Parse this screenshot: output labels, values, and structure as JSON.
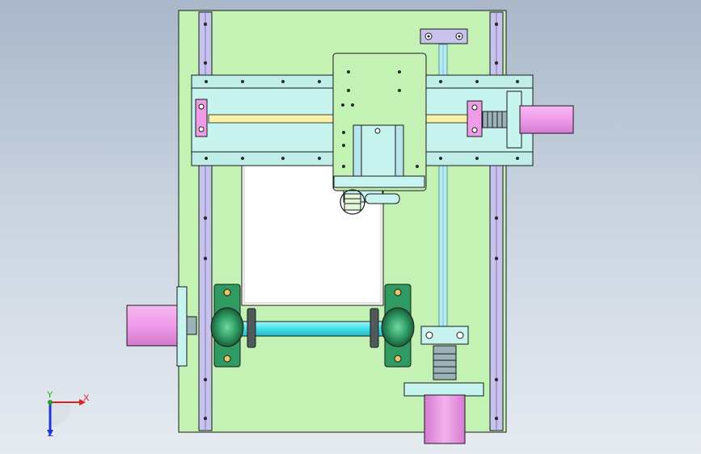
{
  "viewport": {
    "background_top": "#a9b7c9",
    "background_bottom": "#e6ebf1"
  },
  "colors": {
    "plate_green": "#c3f2b4",
    "rail_purple": "#c7c3ec",
    "rail_cyan": "#c8f4f0",
    "motor_pink": "#ee9be8",
    "shaft_cyan": "#56e8f0",
    "bearing_green": "#2f9a62",
    "rod_yellow": "#f6f3a8",
    "outline": "#1a1a1a"
  },
  "icons": {
    "triad": "coordinate-triad-icon"
  },
  "triad": {
    "x_label": "X",
    "y_label": "Y",
    "z_label": "Z",
    "x_color": "#e02020",
    "y_color": "#1fa01f",
    "z_color": "#2038d0"
  }
}
